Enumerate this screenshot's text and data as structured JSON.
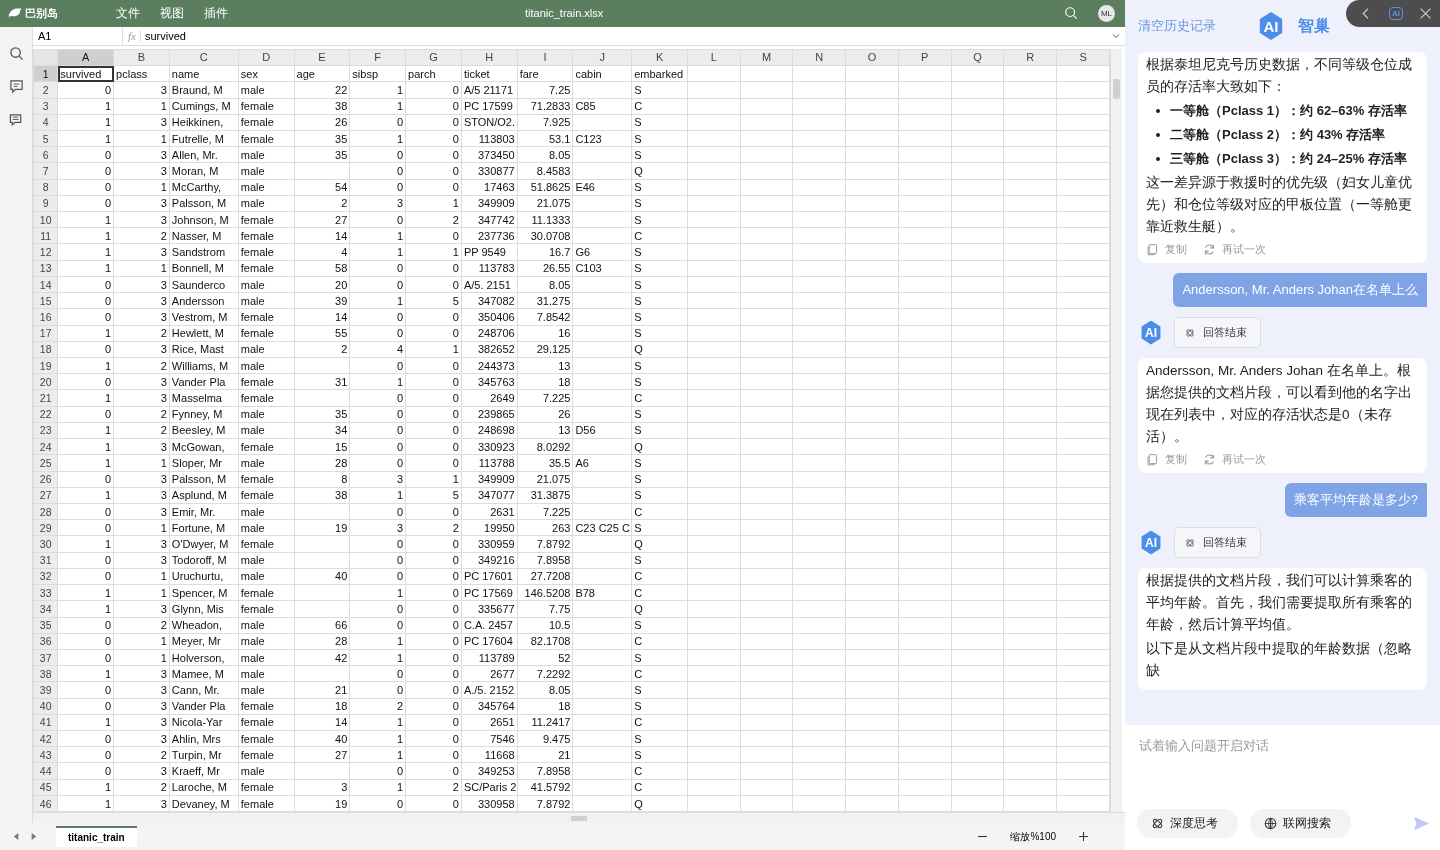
{
  "app": {
    "name": "巴别岛",
    "menu": [
      "文件",
      "视图",
      "插件"
    ],
    "file_title": "titanic_train.xlsx",
    "avatar": "ML"
  },
  "formula_bar": {
    "cell": "A1",
    "fx": "fx",
    "value": "survived"
  },
  "sheet": {
    "columns": [
      {
        "label": "A",
        "selected": true
      },
      {
        "label": "B",
        "selected": false
      },
      {
        "label": "C",
        "selected": false
      },
      {
        "label": "D",
        "selected": false
      },
      {
        "label": "E",
        "selected": false
      },
      {
        "label": "F",
        "selected": false
      },
      {
        "label": "G",
        "selected": false
      },
      {
        "label": "H",
        "selected": false
      },
      {
        "label": "I",
        "selected": false
      },
      {
        "label": "J",
        "selected": false
      },
      {
        "label": "K",
        "selected": false
      },
      {
        "label": "L",
        "selected": false
      },
      {
        "label": "M",
        "selected": false
      },
      {
        "label": "N",
        "selected": false
      },
      {
        "label": "O",
        "selected": false
      },
      {
        "label": "P",
        "selected": false
      },
      {
        "label": "Q",
        "selected": false
      },
      {
        "label": "R",
        "selected": false
      },
      {
        "label": "S",
        "selected": false
      }
    ],
    "rows": [
      {
        "n": "1",
        "selected": true,
        "cells": [
          "survived",
          "pclass",
          "name",
          "sex",
          "age",
          "sibsp",
          "parch",
          "ticket",
          "fare",
          "cabin",
          "embarked"
        ]
      },
      {
        "n": "2",
        "selected": false,
        "cells": [
          "0",
          "3",
          "Braund, M",
          "male",
          "22",
          "1",
          "0",
          "A/5 21171",
          "7.25",
          null,
          "S"
        ]
      },
      {
        "n": "3",
        "selected": false,
        "cells": [
          "1",
          "1",
          "Cumings, M",
          "female",
          "38",
          "1",
          "0",
          "PC 17599",
          "71.2833",
          "C85",
          "C"
        ]
      },
      {
        "n": "4",
        "selected": false,
        "cells": [
          "1",
          "3",
          "Heikkinen,",
          "female",
          "26",
          "0",
          "0",
          "STON/O2.",
          "7.925",
          null,
          "S"
        ]
      },
      {
        "n": "5",
        "selected": false,
        "cells": [
          "1",
          "1",
          "Futrelle, M",
          "female",
          "35",
          "1",
          "0",
          "113803",
          "53.1",
          "C123",
          "S"
        ]
      },
      {
        "n": "6",
        "selected": false,
        "cells": [
          "0",
          "3",
          "Allen, Mr.",
          "male",
          "35",
          "0",
          "0",
          "373450",
          "8.05",
          null,
          "S"
        ]
      },
      {
        "n": "7",
        "selected": false,
        "cells": [
          "0",
          "3",
          "Moran, M",
          "male",
          null,
          "0",
          "0",
          "330877",
          "8.4583",
          null,
          "Q"
        ]
      },
      {
        "n": "8",
        "selected": false,
        "cells": [
          "0",
          "1",
          "McCarthy,",
          "male",
          "54",
          "0",
          "0",
          "17463",
          "51.8625",
          "E46",
          "S"
        ]
      },
      {
        "n": "9",
        "selected": false,
        "cells": [
          "0",
          "3",
          "Palsson, M",
          "male",
          "2",
          "3",
          "1",
          "349909",
          "21.075",
          null,
          "S"
        ]
      },
      {
        "n": "10",
        "selected": false,
        "cells": [
          "1",
          "3",
          "Johnson, M",
          "female",
          "27",
          "0",
          "2",
          "347742",
          "11.1333",
          null,
          "S"
        ]
      },
      {
        "n": "11",
        "selected": false,
        "cells": [
          "1",
          "2",
          "Nasser, M",
          "female",
          "14",
          "1",
          "0",
          "237736",
          "30.0708",
          null,
          "C"
        ]
      },
      {
        "n": "12",
        "selected": false,
        "cells": [
          "1",
          "3",
          "Sandstrom",
          "female",
          "4",
          "1",
          "1",
          "PP 9549",
          "16.7",
          "G6",
          "S"
        ]
      },
      {
        "n": "13",
        "selected": false,
        "cells": [
          "1",
          "1",
          "Bonnell, M",
          "female",
          "58",
          "0",
          "0",
          "113783",
          "26.55",
          "C103",
          "S"
        ]
      },
      {
        "n": "14",
        "selected": false,
        "cells": [
          "0",
          "3",
          "Saunderco",
          "male",
          "20",
          "0",
          "0",
          "A/5. 2151",
          "8.05",
          null,
          "S"
        ]
      },
      {
        "n": "15",
        "selected": false,
        "cells": [
          "0",
          "3",
          "Andersson",
          "male",
          "39",
          "1",
          "5",
          "347082",
          "31.275",
          null,
          "S"
        ]
      },
      {
        "n": "16",
        "selected": false,
        "cells": [
          "0",
          "3",
          "Vestrom, M",
          "female",
          "14",
          "0",
          "0",
          "350406",
          "7.8542",
          null,
          "S"
        ]
      },
      {
        "n": "17",
        "selected": false,
        "cells": [
          "1",
          "2",
          "Hewlett, M",
          "female",
          "55",
          "0",
          "0",
          "248706",
          "16",
          null,
          "S"
        ]
      },
      {
        "n": "18",
        "selected": false,
        "cells": [
          "0",
          "3",
          "Rice, Mast",
          "male",
          "2",
          "4",
          "1",
          "382652",
          "29.125",
          null,
          "Q"
        ]
      },
      {
        "n": "19",
        "selected": false,
        "cells": [
          "1",
          "2",
          "Williams, M",
          "male",
          null,
          "0",
          "0",
          "244373",
          "13",
          null,
          "S"
        ]
      },
      {
        "n": "20",
        "selected": false,
        "cells": [
          "0",
          "3",
          "Vander Pla",
          "female",
          "31",
          "1",
          "0",
          "345763",
          "18",
          null,
          "S"
        ]
      },
      {
        "n": "21",
        "selected": false,
        "cells": [
          "1",
          "3",
          "Masselma",
          "female",
          null,
          "0",
          "0",
          "2649",
          "7.225",
          null,
          "C"
        ]
      },
      {
        "n": "22",
        "selected": false,
        "cells": [
          "0",
          "2",
          "Fynney, M",
          "male",
          "35",
          "0",
          "0",
          "239865",
          "26",
          null,
          "S"
        ]
      },
      {
        "n": "23",
        "selected": false,
        "cells": [
          "1",
          "2",
          "Beesley, M",
          "male",
          "34",
          "0",
          "0",
          "248698",
          "13",
          "D56",
          "S"
        ]
      },
      {
        "n": "24",
        "selected": false,
        "cells": [
          "1",
          "3",
          "McGowan,",
          "female",
          "15",
          "0",
          "0",
          "330923",
          "8.0292",
          null,
          "Q"
        ]
      },
      {
        "n": "25",
        "selected": false,
        "cells": [
          "1",
          "1",
          "Sloper, Mr",
          "male",
          "28",
          "0",
          "0",
          "113788",
          "35.5",
          "A6",
          "S"
        ]
      },
      {
        "n": "26",
        "selected": false,
        "cells": [
          "0",
          "3",
          "Palsson, M",
          "female",
          "8",
          "3",
          "1",
          "349909",
          "21.075",
          null,
          "S"
        ]
      },
      {
        "n": "27",
        "selected": false,
        "cells": [
          "1",
          "3",
          "Asplund, M",
          "female",
          "38",
          "1",
          "5",
          "347077",
          "31.3875",
          null,
          "S"
        ]
      },
      {
        "n": "28",
        "selected": false,
        "cells": [
          "0",
          "3",
          "Emir, Mr.",
          "male",
          null,
          "0",
          "0",
          "2631",
          "7.225",
          null,
          "C"
        ]
      },
      {
        "n": "29",
        "selected": false,
        "cells": [
          "0",
          "1",
          "Fortune, M",
          "male",
          "19",
          "3",
          "2",
          "19950",
          "263",
          "C23 C25 C",
          "S"
        ]
      },
      {
        "n": "30",
        "selected": false,
        "cells": [
          "1",
          "3",
          "O'Dwyer, M",
          "female",
          null,
          "0",
          "0",
          "330959",
          "7.8792",
          null,
          "Q"
        ]
      },
      {
        "n": "31",
        "selected": false,
        "cells": [
          "0",
          "3",
          "Todoroff, M",
          "male",
          null,
          "0",
          "0",
          "349216",
          "7.8958",
          null,
          "S"
        ]
      },
      {
        "n": "32",
        "selected": false,
        "cells": [
          "0",
          "1",
          "Uruchurtu,",
          "male",
          "40",
          "0",
          "0",
          "PC 17601",
          "27.7208",
          null,
          "C"
        ]
      },
      {
        "n": "33",
        "selected": false,
        "cells": [
          "1",
          "1",
          "Spencer, M",
          "female",
          null,
          "1",
          "0",
          "PC 17569",
          "146.5208",
          "B78",
          "C"
        ]
      },
      {
        "n": "34",
        "selected": false,
        "cells": [
          "1",
          "3",
          "Glynn, Mis",
          "female",
          null,
          "0",
          "0",
          "335677",
          "7.75",
          null,
          "Q"
        ]
      },
      {
        "n": "35",
        "selected": false,
        "cells": [
          "0",
          "2",
          "Wheadon,",
          "male",
          "66",
          "0",
          "0",
          "C.A. 2457",
          "10.5",
          null,
          "S"
        ]
      },
      {
        "n": "36",
        "selected": false,
        "cells": [
          "0",
          "1",
          "Meyer, Mr",
          "male",
          "28",
          "1",
          "0",
          "PC 17604",
          "82.1708",
          null,
          "C"
        ]
      },
      {
        "n": "37",
        "selected": false,
        "cells": [
          "0",
          "1",
          "Holverson,",
          "male",
          "42",
          "1",
          "0",
          "113789",
          "52",
          null,
          "S"
        ]
      },
      {
        "n": "38",
        "selected": false,
        "cells": [
          "1",
          "3",
          "Mamee, M",
          "male",
          null,
          "0",
          "0",
          "2677",
          "7.2292",
          null,
          "C"
        ]
      },
      {
        "n": "39",
        "selected": false,
        "cells": [
          "0",
          "3",
          "Cann, Mr.",
          "male",
          "21",
          "0",
          "0",
          "A./5. 2152",
          "8.05",
          null,
          "S"
        ]
      },
      {
        "n": "40",
        "selected": false,
        "cells": [
          "0",
          "3",
          "Vander Pla",
          "female",
          "18",
          "2",
          "0",
          "345764",
          "18",
          null,
          "S"
        ]
      },
      {
        "n": "41",
        "selected": false,
        "cells": [
          "1",
          "3",
          "Nicola-Yar",
          "female",
          "14",
          "1",
          "0",
          "2651",
          "11.2417",
          null,
          "C"
        ]
      },
      {
        "n": "42",
        "selected": false,
        "cells": [
          "0",
          "3",
          "Ahlin, Mrs",
          "female",
          "40",
          "1",
          "0",
          "7546",
          "9.475",
          null,
          "S"
        ]
      },
      {
        "n": "43",
        "selected": false,
        "cells": [
          "0",
          "2",
          "Turpin, Mr",
          "female",
          "27",
          "1",
          "0",
          "11668",
          "21",
          null,
          "S"
        ]
      },
      {
        "n": "44",
        "selected": false,
        "cells": [
          "0",
          "3",
          "Kraeff, Mr",
          "male",
          null,
          "0",
          "0",
          "349253",
          "7.8958",
          null,
          "C"
        ]
      },
      {
        "n": "45",
        "selected": false,
        "cells": [
          "1",
          "2",
          "Laroche, M",
          "female",
          "3",
          "1",
          "2",
          "SC/Paris 2",
          "41.5792",
          null,
          "C"
        ]
      },
      {
        "n": "46",
        "selected": false,
        "cells": [
          "1",
          "3",
          "Devaney, M",
          "female",
          "19",
          "0",
          "0",
          "330958",
          "7.8792",
          null,
          "Q"
        ]
      }
    ]
  },
  "sheet_tabs": [
    {
      "label": "titanic_train",
      "selected": true
    }
  ],
  "zoom": {
    "label": "缩放%100"
  },
  "assistant": {
    "clear": "清空历史记录",
    "logo": "AI",
    "title": "智巢",
    "badge": "AI",
    "messages": [
      {
        "kind": "answer",
        "paragraphs": [
          "根据泰坦尼克号历史数据，不同等级仓位成员的存活率大致如下："
        ],
        "bullets": [
          "一等舱（Pclass 1）：约 62–63% 存活率",
          "二等舱（Pclass 2）：约 43% 存活率",
          "三等舱（Pclass 3）：约 24–25% 存活率"
        ],
        "after": [
          "这一差异源于救援时的优先级（妇女儿童优先）和仓位等级对应的甲板位置（一等舱更靠近救生艇）。"
        ],
        "actions": [
          "复制",
          "再试一次"
        ]
      },
      {
        "kind": "question",
        "text": "Andersson, Mr. Anders Johan在名单上么"
      },
      {
        "kind": "status",
        "avatar": "AI",
        "text": "回答结束"
      },
      {
        "kind": "answer",
        "paragraphs": [
          "Andersson, Mr. Anders Johan 在名单上。根据您提供的文档片段，可以看到他的名字出现在列表中，对应的存活状态是0（未存活）。"
        ],
        "actions": [
          "复制",
          "再试一次"
        ]
      },
      {
        "kind": "question",
        "text": "乘客平均年龄是多少?"
      },
      {
        "kind": "status",
        "avatar": "AI",
        "text": "回答结束"
      },
      {
        "kind": "answer",
        "paragraphs": [
          "根据提供的文档片段，我们可以计算乘客的平均年龄。首先，我们需要提取所有乘客的年龄，然后计算平均值。",
          "以下是从文档片段中提取的年龄数据（忽略缺"
        ]
      }
    ],
    "input": {
      "placeholder": "试着输入问题开启对话"
    },
    "tools": [
      {
        "kind": "think",
        "label": "深度思考"
      },
      {
        "kind": "web",
        "label": "联网搜索"
      }
    ]
  }
}
